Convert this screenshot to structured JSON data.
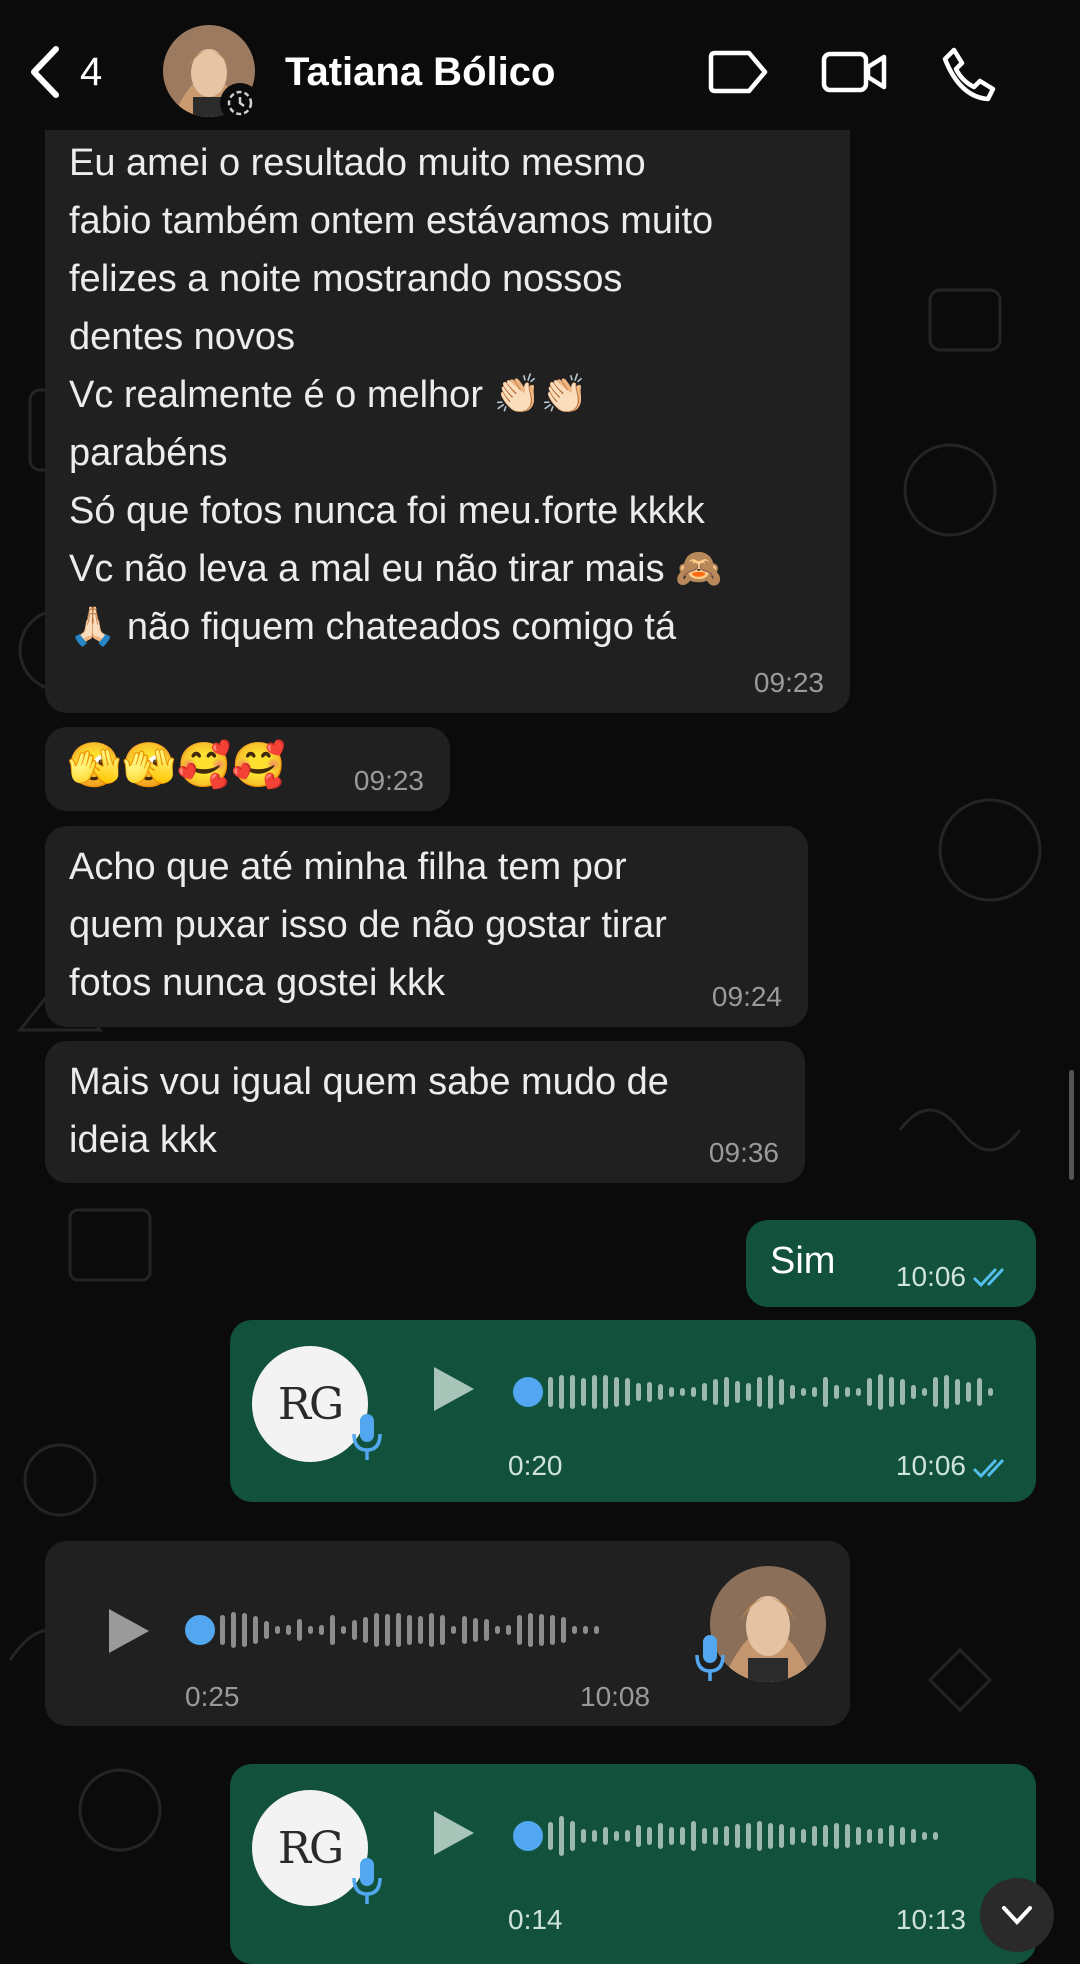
{
  "header": {
    "back_count": "4",
    "contact_name": "Tatiana Bólico"
  },
  "messages": [
    {
      "text": "Eu amei o resultado muito mesmo\nfabio também ontem estávamos muito\nfelizes a noite mostrando nossos\ndentes novos\nVc realmente é o melhor 👏🏻👏🏻\nparabéns\nSó que fotos nunca foi meu.forte kkkk\nVc não leva a mal eu não tirar mais 🙈\n🙏🏻 não fiquem chateados comigo tá",
      "time": "09:23"
    },
    {
      "text": "🫣🫣🥰🥰",
      "time": "09:23"
    },
    {
      "text": "Acho que até minha filha tem por\nquem puxar isso de não gostar tirar\nfotos nunca gostei kkk",
      "time": "09:24"
    },
    {
      "text": "Mais vou igual quem sabe mudo de\nideia kkk",
      "time": "09:36"
    },
    {
      "text": "Sim",
      "time": "10:06"
    }
  ],
  "voice_notes": [
    {
      "avatar_text": "RG",
      "duration": "0:20",
      "time": "10:06",
      "progress": 0
    },
    {
      "duration": "0:25",
      "time": "10:08",
      "progress": 0
    },
    {
      "avatar_text": "RG",
      "duration": "0:14",
      "time": "10:13",
      "progress": 0
    }
  ],
  "colors": {
    "incoming_bubble": "#202020",
    "outgoing_bubble": "#12513b",
    "read_ticks": "#53bdeb",
    "playhead": "#52a7f0"
  }
}
